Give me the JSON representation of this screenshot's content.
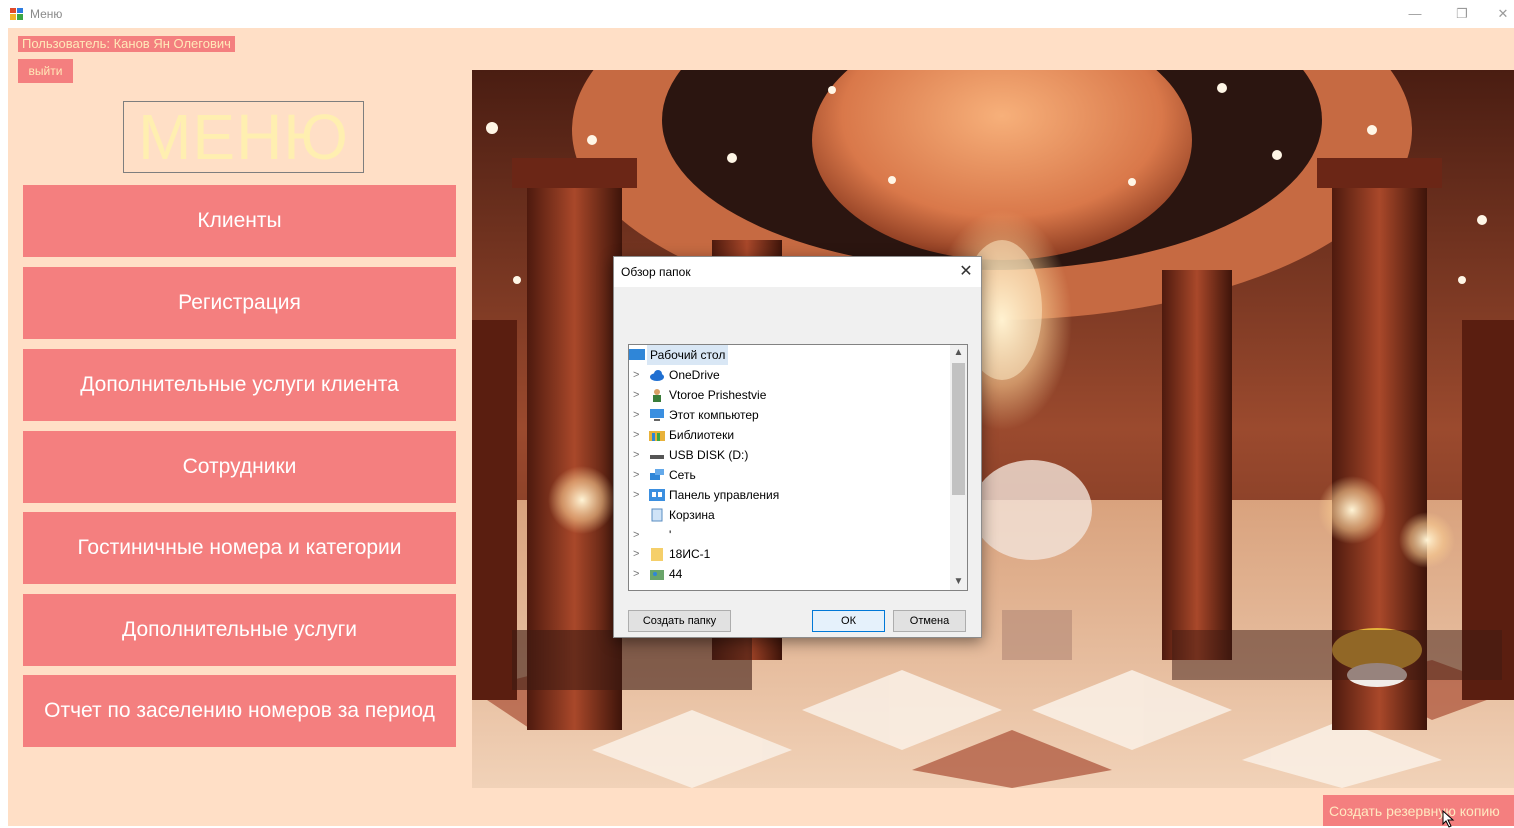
{
  "window": {
    "title": "Меню",
    "minimize": "—",
    "maximize": "❐",
    "close": "✕"
  },
  "user": {
    "label": "Пользователь: Канов Ян Олегович",
    "logout": "выйти"
  },
  "menu": {
    "title": "МЕНЮ",
    "items": [
      "Клиенты",
      "Регистрация",
      "Дополнительные услуги клиента",
      "Сотрудники",
      "Гостиничные номера и категории",
      "Дополнительные услуги",
      "Отчет по заселению номеров за период"
    ]
  },
  "backup_button": "Создать резервную копию",
  "dialog": {
    "title": "Обзор папок",
    "close": "✕",
    "tree": [
      {
        "label": "Рабочий стол",
        "icon": "desktop-icon",
        "expander": ""
      },
      {
        "label": "OneDrive",
        "icon": "cloud-icon",
        "expander": ">"
      },
      {
        "label": "Vtoroe Prishestvie",
        "icon": "user-folder-icon",
        "expander": ">"
      },
      {
        "label": "Этот компьютер",
        "icon": "computer-icon",
        "expander": ">"
      },
      {
        "label": "Библиотеки",
        "icon": "library-icon",
        "expander": ">"
      },
      {
        "label": "USB DISK (D:)",
        "icon": "usb-drive-icon",
        "expander": ">"
      },
      {
        "label": "Сеть",
        "icon": "network-icon",
        "expander": ">"
      },
      {
        "label": "Панель управления",
        "icon": "control-panel-icon",
        "expander": ">"
      },
      {
        "label": "Корзина",
        "icon": "recycle-bin-icon",
        "expander": ""
      },
      {
        "label": "'",
        "icon": "",
        "expander": ">"
      },
      {
        "label": "18ИС-1",
        "icon": "folder-icon",
        "expander": ">"
      },
      {
        "label": "44",
        "icon": "folder-users-icon",
        "expander": ">"
      }
    ],
    "buttons": {
      "new_folder": "Создать папку",
      "ok": "ОК",
      "cancel": "Отмена"
    }
  },
  "colors": {
    "background": "#ffdfc6",
    "button": "#f47f7f",
    "title_text": "#ffefb0"
  }
}
